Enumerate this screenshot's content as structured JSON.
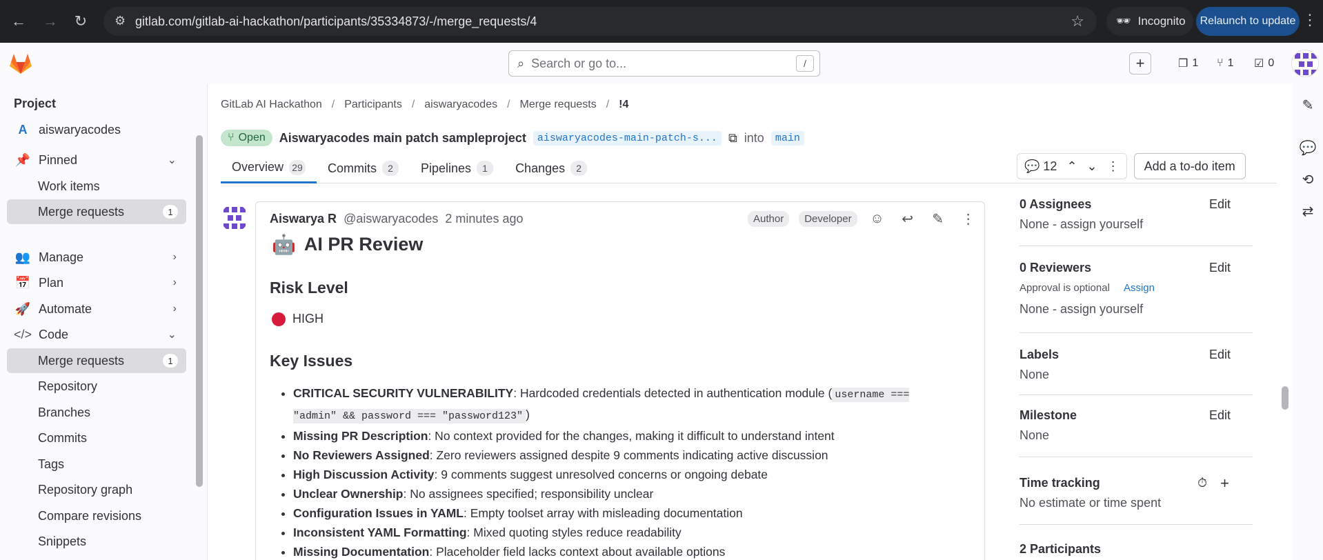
{
  "browser": {
    "url": "gitlab.com/gitlab-ai-hackathon/participants/35334873/-/merge_requests/4",
    "incognito_label": "Incognito",
    "relaunch_label": "Relaunch to update"
  },
  "topbar": {
    "search_placeholder": "Search or go to...",
    "search_shortcut": "/",
    "issues_count": "1",
    "mr_count": "1",
    "todo_count": "0"
  },
  "sidebar": {
    "section_title": "Project",
    "project_initial": "A",
    "project_name": "aiswaryacodes",
    "pinned": "Pinned",
    "pinned_items": [
      "Work items",
      "Merge requests"
    ],
    "pinned_mr_badge": "1",
    "manage": "Manage",
    "plan": "Plan",
    "automate": "Automate",
    "code": "Code",
    "code_items": [
      "Merge requests",
      "Repository",
      "Branches",
      "Commits",
      "Tags",
      "Repository graph",
      "Compare revisions",
      "Snippets"
    ],
    "code_mr_badge": "1"
  },
  "breadcrumb": [
    "GitLab AI Hackathon",
    "Participants",
    "aiswaryacodes",
    "Merge requests",
    "!4"
  ],
  "mr": {
    "status": "Open",
    "title": "Aiswaryacodes main patch sampleproject",
    "source_branch": "aiswaryacodes-main-patch-s...",
    "into": "into",
    "target_branch": "main"
  },
  "tabs": [
    {
      "label": "Overview",
      "count": "29"
    },
    {
      "label": "Commits",
      "count": "2"
    },
    {
      "label": "Pipelines",
      "count": "1"
    },
    {
      "label": "Changes",
      "count": "2"
    }
  ],
  "thread_count": "12",
  "todo_button": "Add a to-do item",
  "note": {
    "author": "Aiswarya R",
    "handle": "@aiswaryacodes",
    "time": "2 minutes ago",
    "badges": [
      "Author",
      "Developer"
    ],
    "heading": "AI PR Review",
    "risk_heading": "Risk Level",
    "risk_value": "HIGH",
    "issues_heading": "Key Issues",
    "issues": [
      {
        "bold": "CRITICAL SECURITY VULNERABILITY",
        "text": ": Hardcoded credentials detected in authentication module (",
        "code": "username === \"admin\" && password === \"password123\"",
        "after": ")"
      },
      {
        "bold": "Missing PR Description",
        "text": ": No context provided for the changes, making it difficult to understand intent"
      },
      {
        "bold": "No Reviewers Assigned",
        "text": ": Zero reviewers assigned despite 9 comments indicating active discussion"
      },
      {
        "bold": "High Discussion Activity",
        "text": ": 9 comments suggest unresolved concerns or ongoing debate"
      },
      {
        "bold": "Unclear Ownership",
        "text": ": No assignees specified; responsibility unclear"
      },
      {
        "bold": "Configuration Issues in YAML",
        "text": ": Empty toolset array with misleading documentation"
      },
      {
        "bold": "Inconsistent YAML Formatting",
        "text": ": Mixed quoting styles reduce readability"
      },
      {
        "bold": "Missing Documentation",
        "text": ": Placeholder field lacks context about available options"
      }
    ]
  },
  "right_sidebar": {
    "assignees_title": "0 Assignees",
    "assignees_value": "None - assign yourself",
    "reviewers_title": "0 Reviewers",
    "approval_text": "Approval is optional",
    "assign_link": "Assign",
    "reviewers_value": "None - assign yourself",
    "labels_title": "Labels",
    "labels_value": "None",
    "milestone_title": "Milestone",
    "milestone_value": "None",
    "time_title": "Time tracking",
    "time_value": "No estimate or time spent",
    "participants_title": "2 Participants",
    "edit_label": "Edit"
  }
}
